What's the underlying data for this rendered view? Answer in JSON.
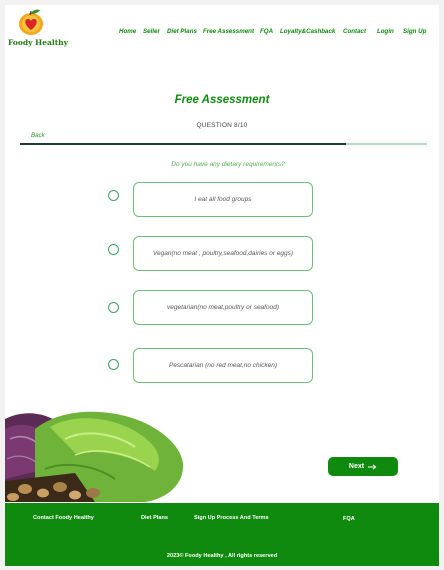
{
  "brand": {
    "name": "Foody Healthy",
    "logo_icon": "apple-heart-logo"
  },
  "nav": [
    {
      "label": "Home"
    },
    {
      "label": "Seller"
    },
    {
      "label": "Diet Plans"
    },
    {
      "label": "Free Assessment"
    },
    {
      "label": "FQA"
    },
    {
      "label": "Loyalty&Cashback"
    },
    {
      "label": "Contact"
    },
    {
      "label": "Login"
    },
    {
      "label": "Sign Up"
    }
  ],
  "assessment": {
    "title": "Free Assessment",
    "question_number": "QUESTION 8/10",
    "back_label": "Back",
    "progress": 0.8,
    "question": "Do you have any dietary requirements?",
    "options": [
      {
        "label": "I eat all food groups",
        "selected": false
      },
      {
        "label": "Vegan(no meat , poultry,seafood,dairies or eggs)",
        "selected": false
      },
      {
        "label": "vegetarian(no meat,poultry or seafood)",
        "selected": false
      },
      {
        "label": "Pescatarian (no red meat,no chicken)",
        "selected": false
      }
    ],
    "next_label": "Next",
    "next_icon": "arrow-right-icon"
  },
  "footer": {
    "links": [
      {
        "label": "Contact Foody Healthy"
      },
      {
        "label": "Diet Plans"
      },
      {
        "label": "Sign Up Process And Terms"
      },
      {
        "label": "FQA"
      }
    ],
    "copyright": "2023© Foody Healthy , All rights reserved"
  },
  "colors": {
    "brand_green": "#0f8a0f",
    "progress_fill": "#1e3a34",
    "option_border": "#6abf7a"
  }
}
